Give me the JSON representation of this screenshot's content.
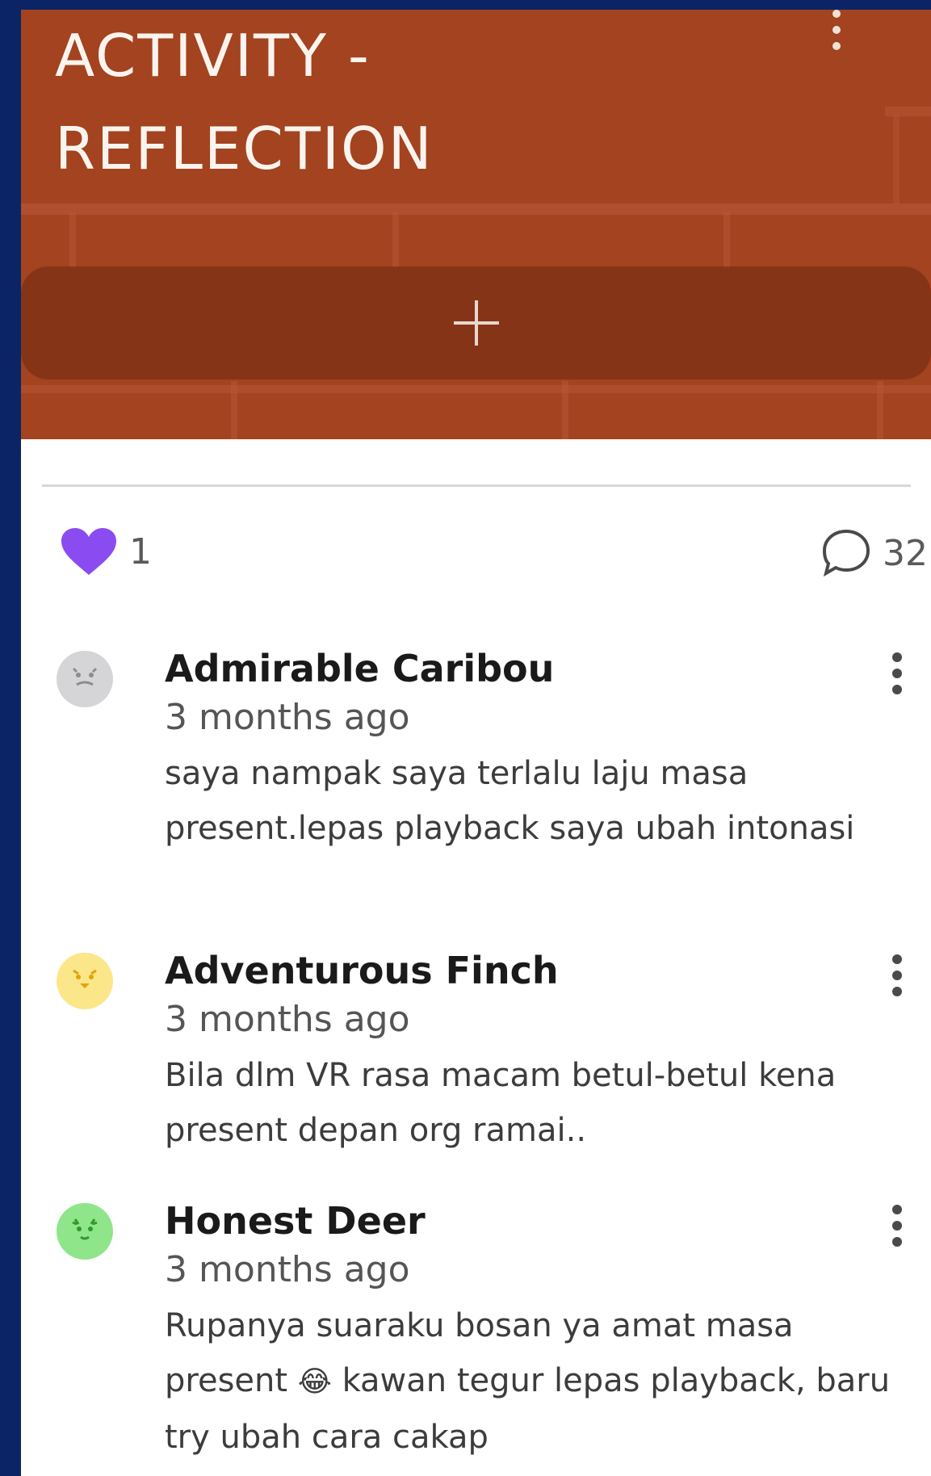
{
  "header": {
    "title": "ACTIVITY -\nREFLECTION",
    "background_color": "#a3431f",
    "more_icon": "vertical-dots-icon",
    "add_icon": "plus-icon"
  },
  "stats": {
    "likes": "1",
    "like_icon": "heart-icon",
    "like_color": "#8a4cf0",
    "comments": "32",
    "comment_icon": "speech-bubble-icon"
  },
  "comments": [
    {
      "author": "Admirable Caribou",
      "time": "3 months ago",
      "text": "saya nampak saya terlalu laju masa present.lepas playback saya ubah intonasi",
      "avatar_color": "#d5d5d8",
      "avatar_icon": "caribou-avatar-icon"
    },
    {
      "author": "Adventurous Finch",
      "time": "3 months ago",
      "text": "Bila dlm VR rasa macam betul-betul kena present depan org ramai..",
      "avatar_color": "#fbe68a",
      "avatar_icon": "finch-avatar-icon"
    },
    {
      "author": "Honest Deer",
      "time": "3 months ago",
      "text_before": "Rupanya suaraku bosan ya amat masa present",
      "emoji": "😂",
      "text_after": "kawan tegur lepas playback, baru try ubah cara cakap",
      "avatar_color": "#8fe58a",
      "avatar_icon": "deer-avatar-icon"
    }
  ]
}
